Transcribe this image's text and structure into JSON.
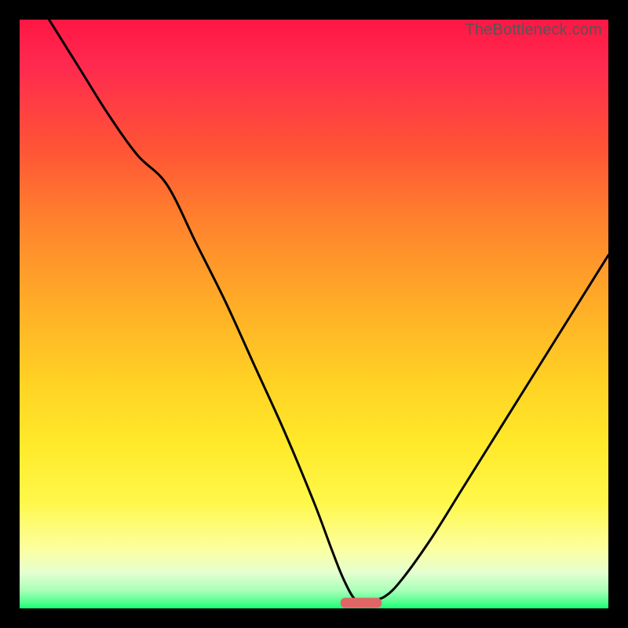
{
  "watermark": "TheBottleneck.com",
  "chart_data": {
    "type": "line",
    "title": "",
    "xlabel": "",
    "ylabel": "",
    "xlim": [
      0,
      100
    ],
    "ylim": [
      0,
      100
    ],
    "series": [
      {
        "name": "bottleneck-curve",
        "x": [
          5,
          10,
          15,
          20,
          25,
          30,
          35,
          40,
          45,
          50,
          53,
          55,
          57,
          59,
          62,
          65,
          70,
          75,
          80,
          85,
          90,
          95,
          100
        ],
        "values": [
          100,
          92,
          84,
          77,
          72,
          62,
          52,
          41,
          30,
          18,
          10,
          5,
          1.5,
          1.2,
          2,
          5,
          12,
          20,
          28,
          36,
          44,
          52,
          60
        ]
      }
    ],
    "marker": {
      "name": "optimum-marker",
      "x": 58,
      "width": 7,
      "y": 1.0,
      "color": "#e06666"
    },
    "gradient_stops": [
      {
        "pos": 0,
        "color": "#ff1744"
      },
      {
        "pos": 8,
        "color": "#ff2a4f"
      },
      {
        "pos": 22,
        "color": "#ff5436"
      },
      {
        "pos": 32,
        "color": "#ff7a2e"
      },
      {
        "pos": 42,
        "color": "#ff9a2a"
      },
      {
        "pos": 52,
        "color": "#ffb726"
      },
      {
        "pos": 62,
        "color": "#ffd324"
      },
      {
        "pos": 72,
        "color": "#ffe92a"
      },
      {
        "pos": 82,
        "color": "#fff84a"
      },
      {
        "pos": 90,
        "color": "#fcffa1"
      },
      {
        "pos": 94,
        "color": "#e4ffd0"
      },
      {
        "pos": 97,
        "color": "#a7ffb8"
      },
      {
        "pos": 99,
        "color": "#4eff8c"
      },
      {
        "pos": 100,
        "color": "#17ff77"
      }
    ]
  }
}
